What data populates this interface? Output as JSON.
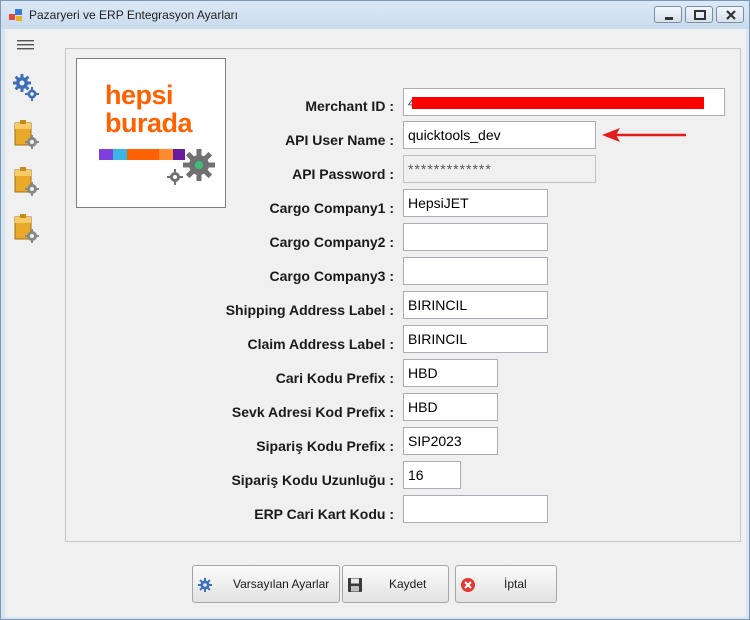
{
  "window": {
    "title": "Pazaryeri ve ERP Entegrasyon Ayarları"
  },
  "logo": {
    "line1": "hepsi",
    "line2": "burada",
    "brand_color": "#ff6000"
  },
  "sidebar": {
    "items": [
      {
        "icon": "gears-icon"
      },
      {
        "icon": "folder-gear-icon"
      },
      {
        "icon": "folder-gear-icon"
      },
      {
        "icon": "folder-gear-icon"
      }
    ]
  },
  "form": {
    "merchant_id": {
      "label": "Merchant ID :",
      "value": "4b6e0f9d-9d80-4b1a-9190-35bc-a6b9c8d4a6e8"
    },
    "api_user_name": {
      "label": "API User Name :",
      "value": "quicktools_dev"
    },
    "api_password": {
      "label": "API Password :",
      "value": "*************"
    },
    "cargo_company1": {
      "label": "Cargo Company1 :",
      "value": "HepsiJET"
    },
    "cargo_company2": {
      "label": "Cargo Company2 :",
      "value": ""
    },
    "cargo_company3": {
      "label": "Cargo Company3 :",
      "value": ""
    },
    "shipping_address_label": {
      "label": "Shipping Address Label :",
      "value": "BIRINCIL"
    },
    "claim_address_label": {
      "label": "Claim Address Label :",
      "value": "BIRINCIL"
    },
    "cari_kodu_prefix": {
      "label": "Cari Kodu Prefix :",
      "value": "HBD"
    },
    "sevk_adresi_kod_prefix": {
      "label": "Sevk Adresi Kod Prefix :",
      "value": "HBD"
    },
    "siparis_kodu_prefix": {
      "label": "Sipariş Kodu Prefix :",
      "value": "SIP2023"
    },
    "siparis_kodu_uzunlugu": {
      "label": "Sipariş Kodu Uzunluğu  :",
      "value": "16"
    },
    "erp_cari_kart_kodu": {
      "label": "ERP Cari Kart Kodu :",
      "value": ""
    }
  },
  "buttons": {
    "defaults": "Varsayılan Ayarlar",
    "save": "Kaydet",
    "cancel": "İptal"
  },
  "colors": {
    "redaction": "#ff0000",
    "annotation_arrow": "#e21b1b"
  }
}
